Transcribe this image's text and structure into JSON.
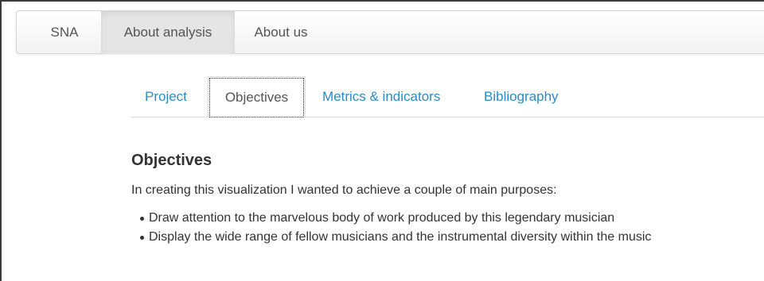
{
  "navbar": {
    "items": [
      {
        "label": "SNA",
        "active": false
      },
      {
        "label": "About analysis",
        "active": true
      },
      {
        "label": "About us",
        "active": false
      }
    ]
  },
  "tabs": [
    {
      "label": "Project",
      "active": false
    },
    {
      "label": "Objectives",
      "active": true
    },
    {
      "label": "Metrics & indicators",
      "active": false
    },
    {
      "label": "Bibliography",
      "active": false
    }
  ],
  "main": {
    "heading": "Objectives",
    "intro": "In creating this visualization I wanted to achieve a couple of main purposes:",
    "bullets": [
      "Draw attention to the marvelous body of work produced by this legendary musician",
      "Display the wide range of fellow musicians and the instrumental diversity within the music"
    ]
  },
  "colors": {
    "link": "#2a8cc8",
    "text": "#333333",
    "nav_active_bg": "#e5e5e5"
  }
}
